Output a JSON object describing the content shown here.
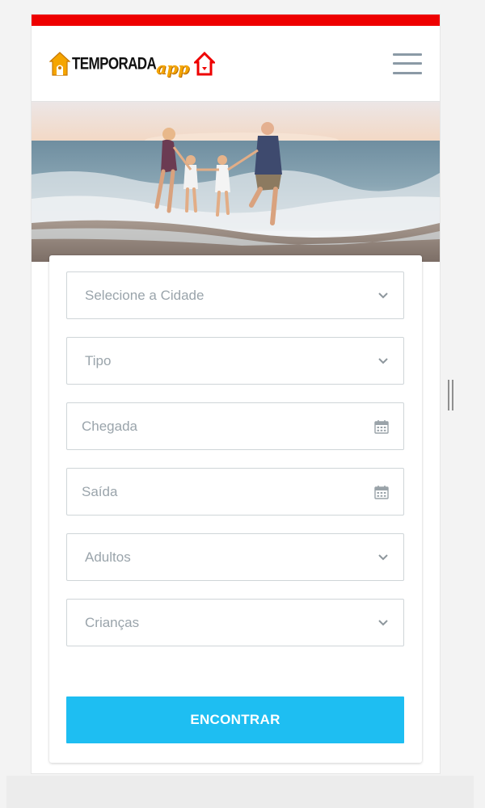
{
  "brand": {
    "name": "Temporada",
    "suffix": "app",
    "accent_red": "#ee0000",
    "accent_orange": "#f5a500",
    "button_blue": "#1ebef2"
  },
  "header": {
    "menu_icon": "hamburger-menu-icon"
  },
  "hero": {
    "image": "family-on-beach-photo"
  },
  "form": {
    "fields": [
      {
        "placeholder": "Selecione a Cidade",
        "type": "select",
        "icon": "chevron-down-icon"
      },
      {
        "placeholder": "Tipo",
        "type": "select",
        "icon": "chevron-down-icon"
      },
      {
        "placeholder": "Chegada",
        "type": "date",
        "icon": "calendar-icon"
      },
      {
        "placeholder": "Saída",
        "type": "date",
        "icon": "calendar-icon"
      },
      {
        "placeholder": "Adultos",
        "type": "select",
        "icon": "chevron-down-icon"
      },
      {
        "placeholder": "Crianças",
        "type": "select",
        "icon": "chevron-down-icon"
      }
    ],
    "submit_label": "ENCONTRAR"
  }
}
